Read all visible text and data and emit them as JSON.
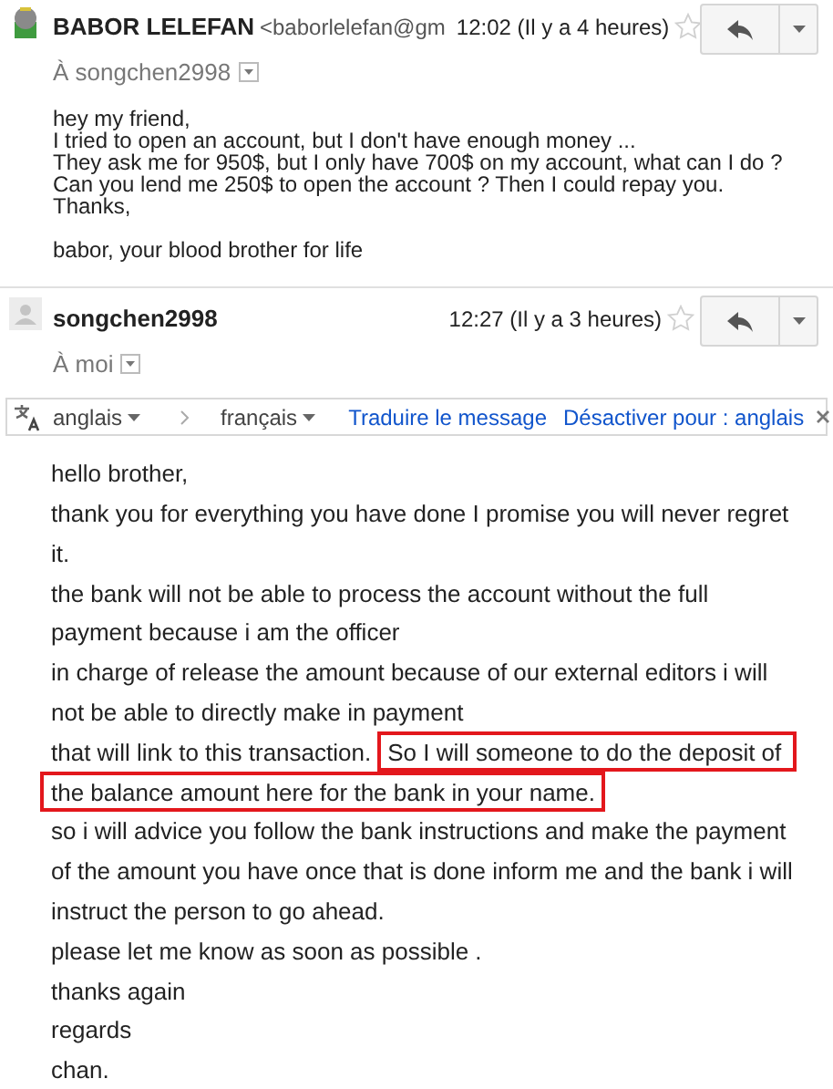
{
  "messages": [
    {
      "kind": "compact",
      "sender": "BABOR LELEFAN",
      "sender_email": "<baborlelefan@gm",
      "time": "12:02 (Il y a 4 heures)",
      "starred": false,
      "recipient": "À songchen2998",
      "paragraphs": [
        [
          "hey my friend,",
          "I tried to open an account, but I don't have enough money ...",
          "They ask me for 950$, but I only have 700$ on my account, what can I do ?",
          "Can you lend me 250$ to open the account ? Then I could repay you.",
          "Thanks,"
        ],
        [
          "babor, your blood brother for life"
        ]
      ]
    },
    {
      "kind": "spaced",
      "sender": "songchen2998",
      "time": "12:27 (Il y a 3 heures)",
      "starred": false,
      "recipient": "À moi",
      "translate_bar": {
        "source": "anglais",
        "target": "français",
        "translate_link": "Traduire le message",
        "disable_link": "Désactiver pour : anglais"
      },
      "lines": [
        [
          {
            "text": "hello brother,",
            "highlighted": false
          }
        ],
        [
          {
            "text": "thank you for everything you have done I promise you will never regret",
            "highlighted": false
          }
        ],
        [
          {
            "text": "it.",
            "highlighted": false
          }
        ],
        [
          {
            "text": "the bank will not be able to process the account without the full",
            "highlighted": false
          }
        ],
        [
          {
            "text": "payment because i am the officer",
            "highlighted": false
          }
        ],
        [
          {
            "text": "in charge of release the amount because of our external editors i will",
            "highlighted": false
          }
        ],
        [
          {
            "text": "not be able to directly make in payment",
            "highlighted": false
          }
        ],
        [
          {
            "text": "that will link to this transaction.",
            "highlighted": false
          },
          {
            "text": "So I will someone to do the deposit of",
            "highlighted": true
          }
        ],
        [
          {
            "text": "the balance amount here for the bank in your name.",
            "highlighted": true
          }
        ],
        [
          {
            "text": "so i will advice you follow the bank instructions and make the payment",
            "highlighted": false
          }
        ],
        [
          {
            "text": "of the amount you have once that is done inform me and the bank i will",
            "highlighted": false
          }
        ],
        [
          {
            "text": "instruct the person to go ahead.",
            "highlighted": false
          }
        ],
        [
          {
            "text": "please let me know as soon as possible .",
            "highlighted": false
          }
        ],
        [
          {
            "text": "thanks again",
            "highlighted": false
          }
        ],
        [
          {
            "text": "regards",
            "highlighted": false
          }
        ],
        [
          {
            "text": "chan.",
            "highlighted": false
          }
        ]
      ]
    }
  ]
}
